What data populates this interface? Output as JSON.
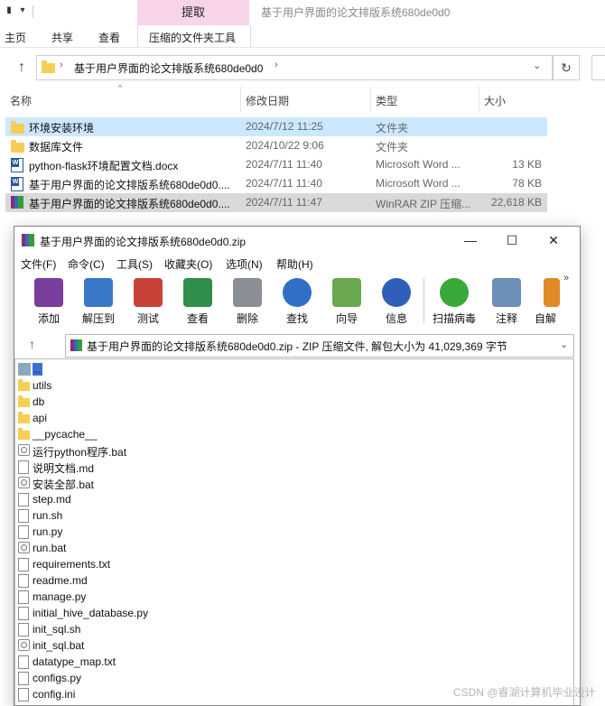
{
  "explorer": {
    "window_title": "基于用户界面的论文排版系统680de0d0",
    "extract_tab": "提取",
    "menu": [
      "主页",
      "共享",
      "查看"
    ],
    "tools_tab": "压缩的文件夹工具",
    "address": "基于用户界面的论文排版系统680de0d0",
    "columns": {
      "name": "名称",
      "date": "修改日期",
      "type": "类型",
      "size": "大小"
    },
    "files": [
      {
        "name": "环境安装环境",
        "date": "2024/7/12 11:25",
        "type": "文件夹",
        "size": "",
        "icon": "folder"
      },
      {
        "name": "数据库文件",
        "date": "2024/10/22 9:06",
        "type": "文件夹",
        "size": "",
        "icon": "folder"
      },
      {
        "name": "python-flask环境配置文档.docx",
        "date": "2024/7/11 11:40",
        "type": "Microsoft Word ...",
        "size": "13 KB",
        "icon": "word"
      },
      {
        "name": "基于用户界面的论文排版系统680de0d0....",
        "date": "2024/7/11 11:40",
        "type": "Microsoft Word ...",
        "size": "78 KB",
        "icon": "word"
      },
      {
        "name": "基于用户界面的论文排版系统680de0d0....",
        "date": "2024/7/11 11:47",
        "type": "WinRAR ZIP 压缩...",
        "size": "22,618 KB",
        "icon": "rar"
      }
    ]
  },
  "winrar": {
    "title": "基于用户界面的论文排版系统680de0d0.zip",
    "menu": [
      "文件(F)",
      "命令(C)",
      "工具(S)",
      "收藏夹(O)",
      "选项(N)",
      "帮助(H)"
    ],
    "toolbar": [
      {
        "label": "添加",
        "icon": "add-icon",
        "color": "#7a3e9c"
      },
      {
        "label": "解压到",
        "icon": "extract-to-icon",
        "color": "#3a78c8"
      },
      {
        "label": "测试",
        "icon": "test-icon",
        "color": "#c8423a"
      },
      {
        "label": "查看",
        "icon": "view-icon",
        "color": "#2f8f4a"
      },
      {
        "label": "删除",
        "icon": "delete-icon",
        "color": "#8a8f96"
      },
      {
        "label": "查找",
        "icon": "find-icon",
        "color": "#2f6fc8"
      },
      {
        "label": "向导",
        "icon": "wizard-icon",
        "color": "#6aa84f"
      },
      {
        "label": "信息",
        "icon": "info-icon",
        "color": "#2f5fb8"
      },
      {
        "label": "扫描病毒",
        "icon": "scan-virus-icon",
        "color": "#3aa83a"
      },
      {
        "label": "注释",
        "icon": "comment-icon",
        "color": "#6c8fb8"
      },
      {
        "label": "自解",
        "icon": "sfx-icon",
        "color": "#e08a2a"
      }
    ],
    "address": "基于用户界面的论文排版系统680de0d0.zip - ZIP 压缩文件, 解包大小为 41,029,369 字节",
    "entries": [
      {
        "name": "..",
        "icon": "up"
      },
      {
        "name": "utils",
        "icon": "folder"
      },
      {
        "name": "db",
        "icon": "folder"
      },
      {
        "name": "api",
        "icon": "folder"
      },
      {
        "name": "__pycache__",
        "icon": "folder"
      },
      {
        "name": "运行python程序.bat",
        "icon": "bat"
      },
      {
        "name": "说明文档.md",
        "icon": "file"
      },
      {
        "name": "安装全部.bat",
        "icon": "bat"
      },
      {
        "name": "step.md",
        "icon": "file"
      },
      {
        "name": "run.sh",
        "icon": "file"
      },
      {
        "name": "run.py",
        "icon": "file"
      },
      {
        "name": "run.bat",
        "icon": "bat"
      },
      {
        "name": "requirements.txt",
        "icon": "file"
      },
      {
        "name": "readme.md",
        "icon": "file"
      },
      {
        "name": "manage.py",
        "icon": "file"
      },
      {
        "name": "initial_hive_database.py",
        "icon": "file"
      },
      {
        "name": "init_sql.sh",
        "icon": "file"
      },
      {
        "name": "init_sql.bat",
        "icon": "bat"
      },
      {
        "name": "datatype_map.txt",
        "icon": "file"
      },
      {
        "name": "configs.py",
        "icon": "file"
      },
      {
        "name": "config.ini",
        "icon": "file"
      }
    ]
  },
  "watermark": "CSDN @睿湖计算机毕业设计"
}
